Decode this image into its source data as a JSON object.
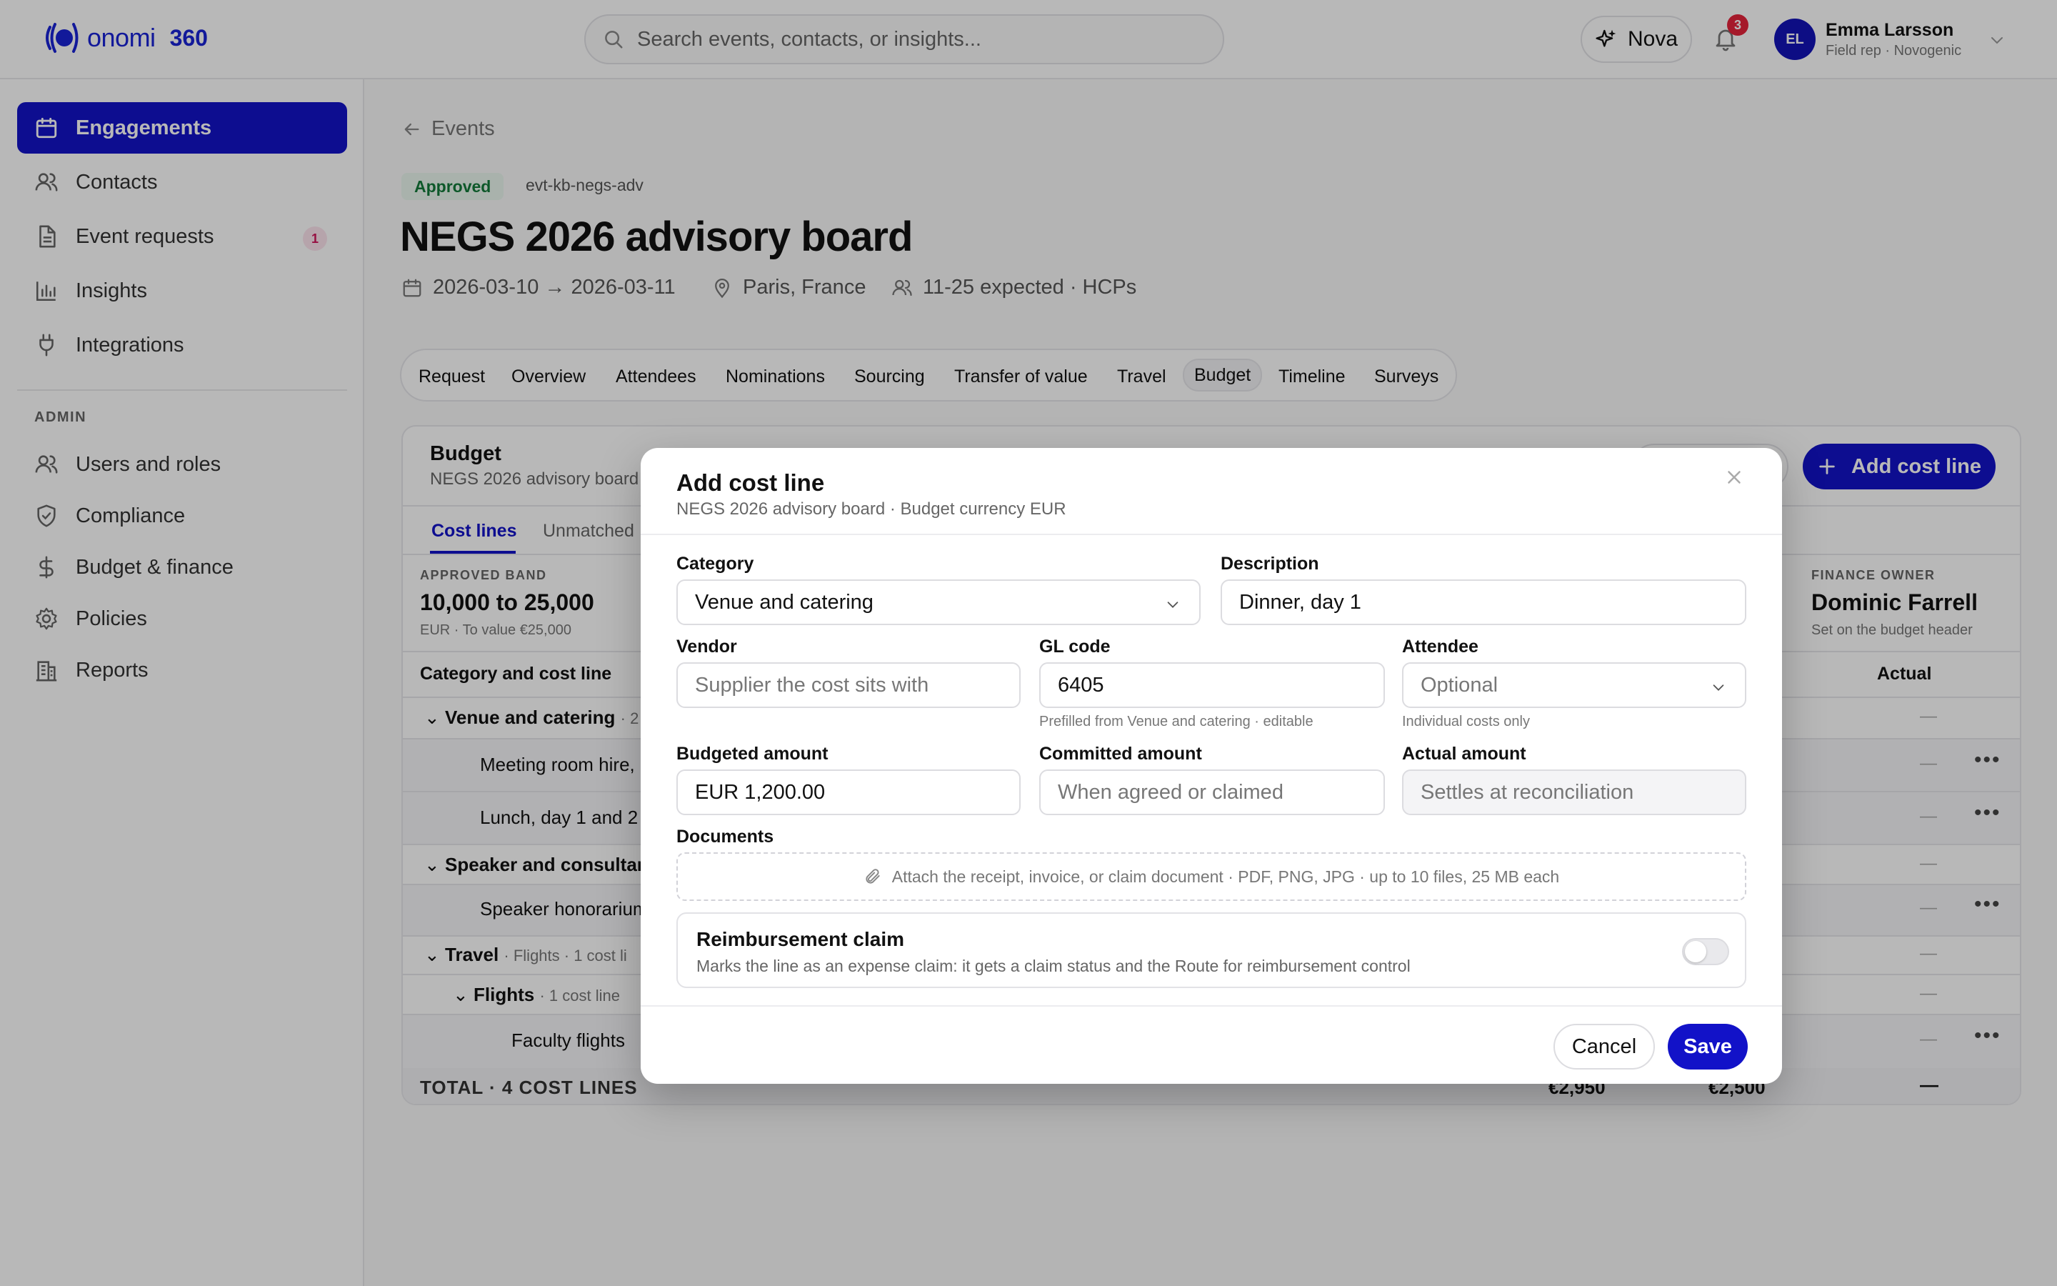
{
  "brand": {
    "name": "onomi",
    "suffix": "360",
    "accent": "#1212c8"
  },
  "search": {
    "placeholder": "Search events, contacts, or insights..."
  },
  "header": {
    "nova_label": "Nova",
    "notifications_count": "3",
    "user": {
      "initials": "EL",
      "name": "Emma Larsson",
      "role": "Field rep · Novogenic"
    }
  },
  "sidebar": {
    "items": [
      {
        "label": "Engagements",
        "icon": "calendar-icon",
        "active": true
      },
      {
        "label": "Contacts",
        "icon": "users-icon"
      },
      {
        "label": "Event requests",
        "icon": "document-icon",
        "badge": "1"
      },
      {
        "label": "Insights",
        "icon": "bar-chart-icon"
      },
      {
        "label": "Integrations",
        "icon": "plug-icon"
      }
    ],
    "admin_label": "ADMIN",
    "admin_items": [
      {
        "label": "Users and roles",
        "icon": "users-icon"
      },
      {
        "label": "Compliance",
        "icon": "shield-icon"
      },
      {
        "label": "Budget & finance",
        "icon": "dollar-icon"
      },
      {
        "label": "Policies",
        "icon": "gear-icon"
      },
      {
        "label": "Reports",
        "icon": "building-icon"
      }
    ]
  },
  "event": {
    "back_label": "Events",
    "status": "Approved",
    "id": "evt-kb-negs-adv",
    "title": "NEGS 2026 advisory board",
    "dates": "2026-03-10 → 2026-03-11",
    "location": "Paris, France",
    "attendance": "11-25 expected · HCPs"
  },
  "tabs": [
    "Request",
    "Overview",
    "Attendees",
    "Nominations",
    "Sourcing",
    "Transfer of value",
    "Travel",
    "Budget",
    "Timeline",
    "Surveys"
  ],
  "budget": {
    "title": "Budget",
    "subtitle": "NEGS 2026 advisory board",
    "add_cost_line_label": "Add cost line",
    "subtabs": [
      "Cost lines",
      "Unmatched"
    ],
    "approved_band": {
      "label": "APPROVED BAND",
      "value": "10,000 to 25,000",
      "note": "EUR · To value €25,000"
    },
    "finance_owner": {
      "label": "FINANCE OWNER",
      "value": "Dominic Farrell",
      "note": "Set on the budget header"
    },
    "columns": {
      "category": "Category and cost line",
      "actual": "Actual"
    },
    "rows": [
      {
        "label": "Venue and catering",
        "meta": "· 2",
        "level": 0
      },
      {
        "label": "Meeting room hire,",
        "level": 2
      },
      {
        "label": "Lunch, day 1 and 2",
        "level": 2
      },
      {
        "label": "Speaker and consultan",
        "level": 0
      },
      {
        "label": "Speaker honorarium",
        "level": 2
      },
      {
        "label": "Travel",
        "meta": "· Flights · 1 cost li",
        "level": 0
      },
      {
        "label": "Flights",
        "meta": "· 1 cost line",
        "level": 1
      },
      {
        "label": "Faculty flights",
        "level": 3
      }
    ],
    "dash": "—",
    "total": {
      "label": "TOTAL · 4 COST LINES",
      "budgeted": "€2,950",
      "committed": "€2,500",
      "actual": "—"
    }
  },
  "modal": {
    "title": "Add cost line",
    "subtitle": "NEGS 2026 advisory board · Budget currency EUR",
    "category": {
      "label": "Category",
      "value": "Venue and catering"
    },
    "description": {
      "label": "Description",
      "value": "Dinner, day 1"
    },
    "vendor": {
      "label": "Vendor",
      "placeholder": "Supplier the cost sits with"
    },
    "gl_code": {
      "label": "GL code",
      "value": "6405",
      "hint": "Prefilled from Venue and catering · editable"
    },
    "attendee": {
      "label": "Attendee",
      "placeholder": "Optional",
      "hint": "Individual costs only"
    },
    "budgeted": {
      "label": "Budgeted amount",
      "value": "EUR 1,200.00"
    },
    "committed": {
      "label": "Committed amount",
      "placeholder": "When agreed or claimed"
    },
    "actual": {
      "label": "Actual amount",
      "placeholder": "Settles at reconciliation"
    },
    "documents": {
      "label": "Documents",
      "dropzone": "Attach the receipt, invoice, or claim document · PDF, PNG, JPG · up to 10 files, 25 MB each"
    },
    "reimbursement": {
      "title": "Reimbursement claim",
      "description": "Marks the line as an expense claim: it gets a claim status and the Route for reimbursement control",
      "enabled": false
    },
    "cancel_label": "Cancel",
    "save_label": "Save"
  }
}
